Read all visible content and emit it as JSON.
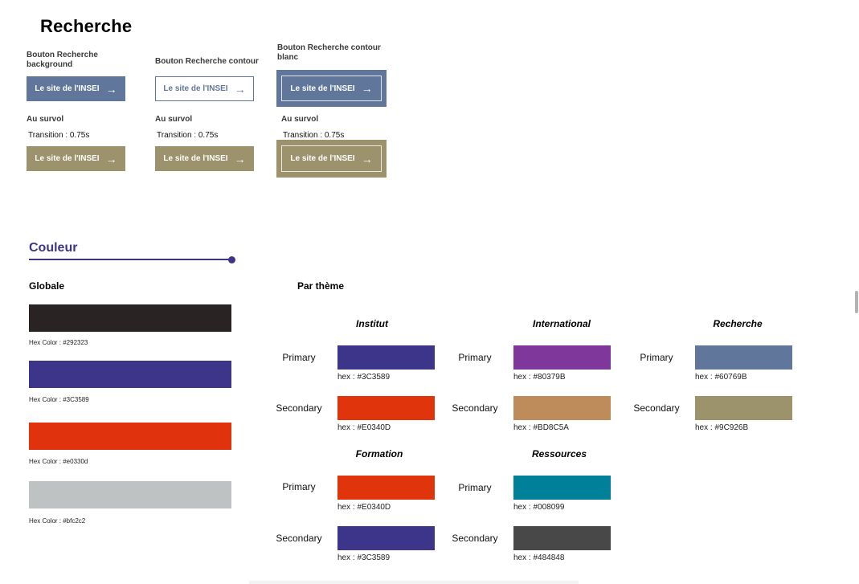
{
  "recherche": {
    "title": "Recherche",
    "columns": [
      {
        "label": "Bouton Recherche background",
        "button_label": "Le site de l'INSEI",
        "hover_label": "Au survol",
        "transition": "Transition :  0.75s",
        "hover_button_label": "Le site de l'INSEI"
      },
      {
        "label": "Bouton Recherche contour",
        "button_label": "Le site de l'INSEI",
        "hover_label": "Au survol",
        "transition": "Transition :  0.75s",
        "hover_button_label": "Le site de l'INSEI"
      },
      {
        "label": "Bouton Recherche contour blanc",
        "button_label": "Le site de l'INSEI",
        "hover_label": "Au survol",
        "transition": "Transition :  0.75s",
        "hover_button_label": "Le site de l'INSEI"
      }
    ],
    "arrow_icon": "→",
    "colors": {
      "primary": "#60769B",
      "hover": "#9C926B"
    }
  },
  "couleur": {
    "title": "Couleur",
    "accent": "#3C3589",
    "globale": {
      "title": "Globale",
      "swatches": [
        {
          "color": "#292323",
          "caption": "Hex Color : #292323"
        },
        {
          "color": "#3C3589",
          "caption": "Hex Color : #3C3589"
        },
        {
          "color": "#e0330d",
          "caption": "Hex Color : #e0330d"
        },
        {
          "color": "#bfc2c2",
          "caption": "Hex Color : #bfc2c2"
        }
      ]
    },
    "par_theme": {
      "title": "Par thème",
      "themes": [
        {
          "name": "Institut",
          "primary_label": "Primary",
          "primary": "#3C3589",
          "primary_hex": "hex : #3C3589",
          "secondary_label": "Secondary",
          "secondary": "#E0340D",
          "secondary_hex": "hex : #E0340D"
        },
        {
          "name": "International",
          "primary_label": "Primary",
          "primary": "#80379B",
          "primary_hex": "hex : #80379B",
          "secondary_label": "Secondary",
          "secondary": "#BD8C5A",
          "secondary_hex": "hex : #BD8C5A"
        },
        {
          "name": "Recherche",
          "primary_label": "Primary",
          "primary": "#60769B",
          "primary_hex": "hex : #60769B",
          "secondary_label": "Secondary",
          "secondary": "#9C926B",
          "secondary_hex": "hex : #9C926B"
        },
        {
          "name": "Formation",
          "primary_label": "Primary",
          "primary": "#E0340D",
          "primary_hex": "hex : #E0340D",
          "secondary_label": "Secondary",
          "secondary": "#3C3589",
          "secondary_hex": "hex : #3C3589"
        },
        {
          "name": "Ressources",
          "primary_label": "Primary",
          "primary": "#008099",
          "primary_hex": "hex : #008099",
          "secondary_label": "Secondary",
          "secondary": "#484848",
          "secondary_hex": "hex : #484848"
        }
      ]
    }
  }
}
